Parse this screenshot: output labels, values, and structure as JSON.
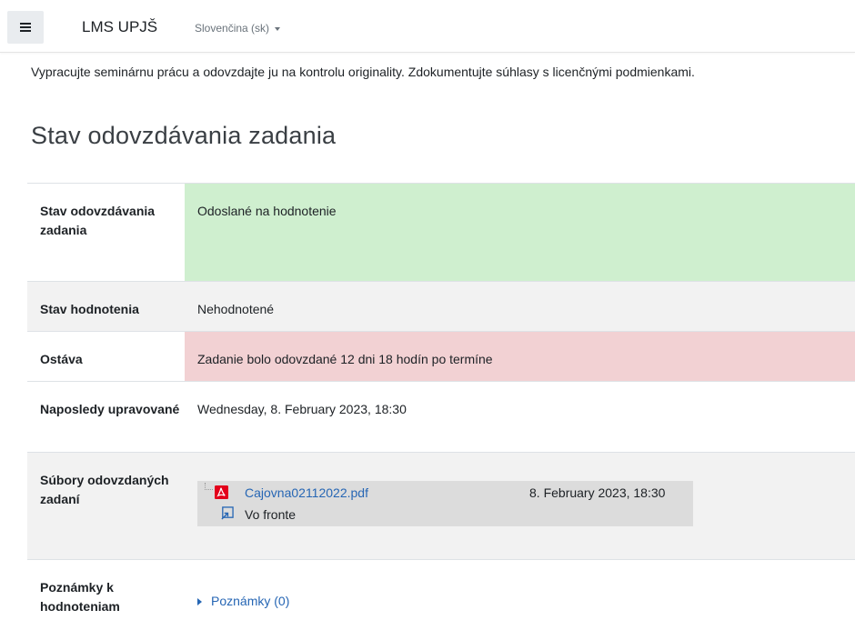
{
  "navbar": {
    "site_name": "LMS UPJŠ",
    "language": "Slovenčina (sk)"
  },
  "intro_text": "Vypracujte seminárnu prácu a odovzdajte ju na kontrolu originality. Zdokumentujte súhlasy s licenčnými podmienkami.",
  "section_title": "Stav odovzdávania zadania",
  "status_rows": {
    "submission_status": {
      "label": "Stav odovzdávania zadania",
      "value": "Odoslané na hodnotenie"
    },
    "grading_status": {
      "label": "Stav hodnotenia",
      "value": "Nehodnotené"
    },
    "time_remaining": {
      "label": "Ostáva",
      "value": "Zadanie bolo odovzdané 12 dni 18 hodín po termíne"
    },
    "last_modified": {
      "label": "Naposledy upravované",
      "value": "Wednesday, 8. February 2023, 18:30"
    },
    "file_submissions": {
      "label": "Súbory odovzdaných zadaní",
      "file_name": "Cajovna02112022.pdf",
      "file_date": "8. February 2023, 18:30",
      "queue_status": "Vo fronte"
    },
    "submission_comments": {
      "label": "Poznámky k hodnoteniam",
      "link": "Poznámky (0)"
    }
  },
  "colors": {
    "success_bg": "#cfefcf",
    "danger_bg": "#f2d1d3",
    "stripe_bg": "#f2f2f2",
    "link": "#2666b4"
  },
  "icons": {
    "menu": "hamburger-icon",
    "language_caret": "caret-down-icon",
    "file_type": "pdf-icon",
    "queue": "queue-icon",
    "expand": "triangle-right-icon"
  }
}
